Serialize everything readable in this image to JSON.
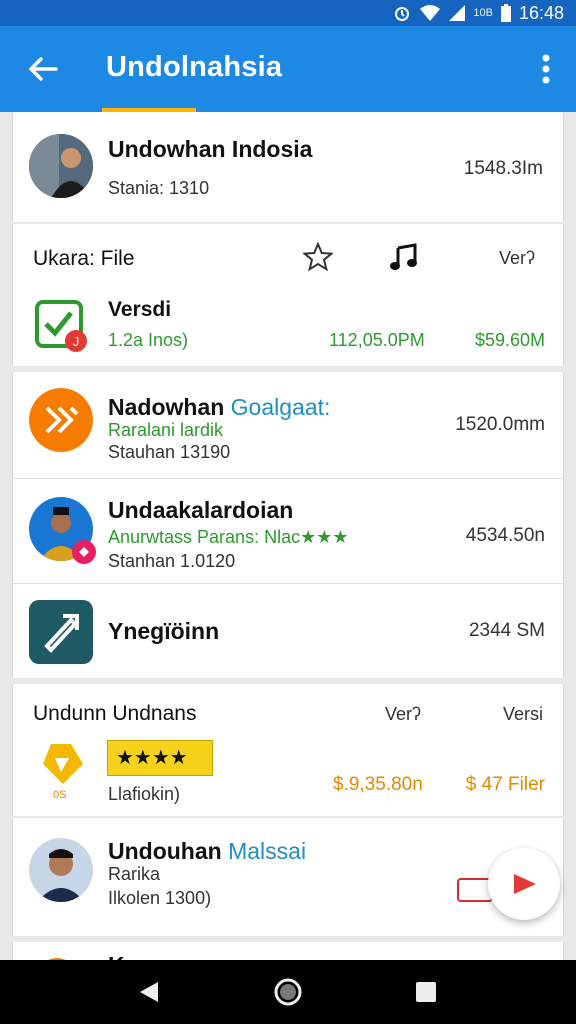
{
  "status_bar": {
    "signal_text": "10B",
    "time": "16:48"
  },
  "app_bar": {
    "title": "Undolnahsia"
  },
  "list": {
    "item1": {
      "title": "Undowhan Indosia",
      "subtitle": "Stania: 1310",
      "size": "1548.3Im"
    },
    "section_file": {
      "header": "Ukara: File",
      "col_version": "Verʔ",
      "row": {
        "title": "Versdi",
        "subtitle": "1.2a Inos)",
        "size_col": "112,05.0PM",
        "price_col": "$59.60M"
      }
    },
    "item_nadowhan": {
      "title": "Nadowhan",
      "title_accent": "Goalgaat:",
      "green": "Raralani lardik",
      "sub": "Stauhan 13190",
      "size": "1520.0mm"
    },
    "item_undaaka": {
      "title": "Undaakalardoian",
      "green": "Anurwtass Parans: Nlac",
      "stars": "★★★",
      "sub": "Stanhan 1.0120",
      "size": "4534.50n"
    },
    "item_ynegi": {
      "title": "Ynegïöinn",
      "size": "2344 SM"
    },
    "section_undun": {
      "header": "Undunn Undnans",
      "col_version": "Verʔ",
      "col_version2": "Versi",
      "row": {
        "stars": "★★★★",
        "subtitle": "Llafiokin)",
        "price": "$.9,35.80n",
        "price2": "$ 47 Filer",
        "icon_text": "0S"
      }
    },
    "item_malssai": {
      "title": "Undouhan",
      "title_accent": "Malssai",
      "sub1": "Rarika",
      "sub2": "Ilkolen 1300)"
    },
    "item_partial": {
      "title": "K"
    }
  },
  "colors": {
    "app_bar": "#1e88e5",
    "status_bar": "#1565c0",
    "accent_underline": "#ffb300",
    "green_text": "#2e9a2e",
    "orange_text": "#e08a00",
    "teal_accent": "#1e8fc4"
  },
  "icons": [
    "back-arrow-icon",
    "more-vert-icon",
    "star-outline-icon",
    "music-note-icon",
    "search-icon",
    "check-app-icon",
    "badge-icon",
    "orange-app-icon",
    "pink-badge-icon",
    "teal-app-icon",
    "yellow-app-icon",
    "play-icon",
    "nav-back-icon",
    "nav-home-icon",
    "nav-recents-icon",
    "wifi-icon",
    "battery-icon",
    "alarm-icon"
  ]
}
